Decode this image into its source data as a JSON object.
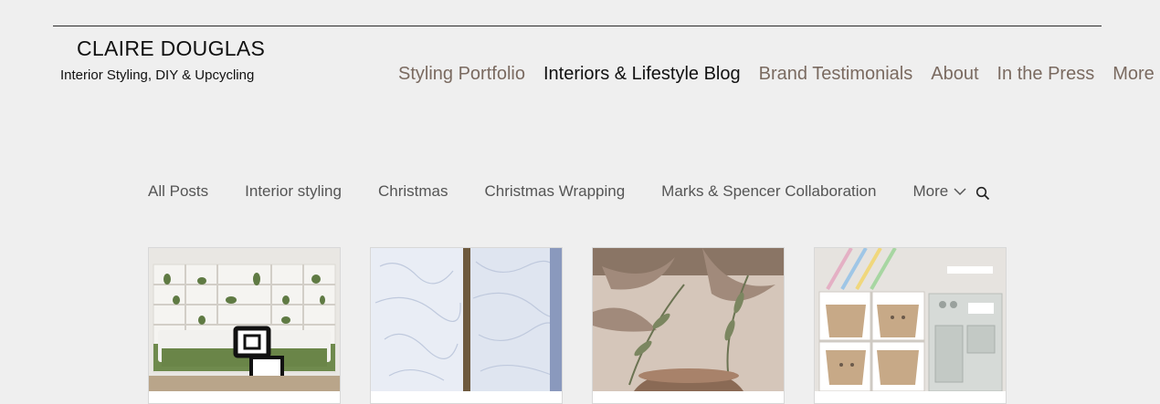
{
  "site": {
    "name": "CLAIRE DOUGLAS",
    "tagline": "Interior Styling, DIY & Upcycling"
  },
  "nav": {
    "items": [
      {
        "label": "Styling Portfolio",
        "active": false
      },
      {
        "label": "Interiors & Lifestyle Blog",
        "active": true
      },
      {
        "label": "Brand Testimonials",
        "active": false
      },
      {
        "label": "About",
        "active": false
      },
      {
        "label": "In the Press",
        "active": false
      },
      {
        "label": "More",
        "active": false
      }
    ]
  },
  "blog_categories": {
    "items": [
      "All Posts",
      "Interior styling",
      "Christmas",
      "Christmas Wrapping",
      "Marks & Spencer Collaboration"
    ],
    "more_label": "More",
    "search_icon": "search-icon"
  },
  "posts": [
    {
      "image": "living-room-shelving-photo"
    },
    {
      "image": "textured-white-plaster-art-photo"
    },
    {
      "image": "dried-foliage-vase-photo"
    },
    {
      "image": "kids-storage-and-play-kitchen-photo"
    }
  ],
  "colors": {
    "background": "#efefef",
    "nav_text": "#7a6a60",
    "nav_active": "#111111",
    "category_text": "#555555"
  }
}
